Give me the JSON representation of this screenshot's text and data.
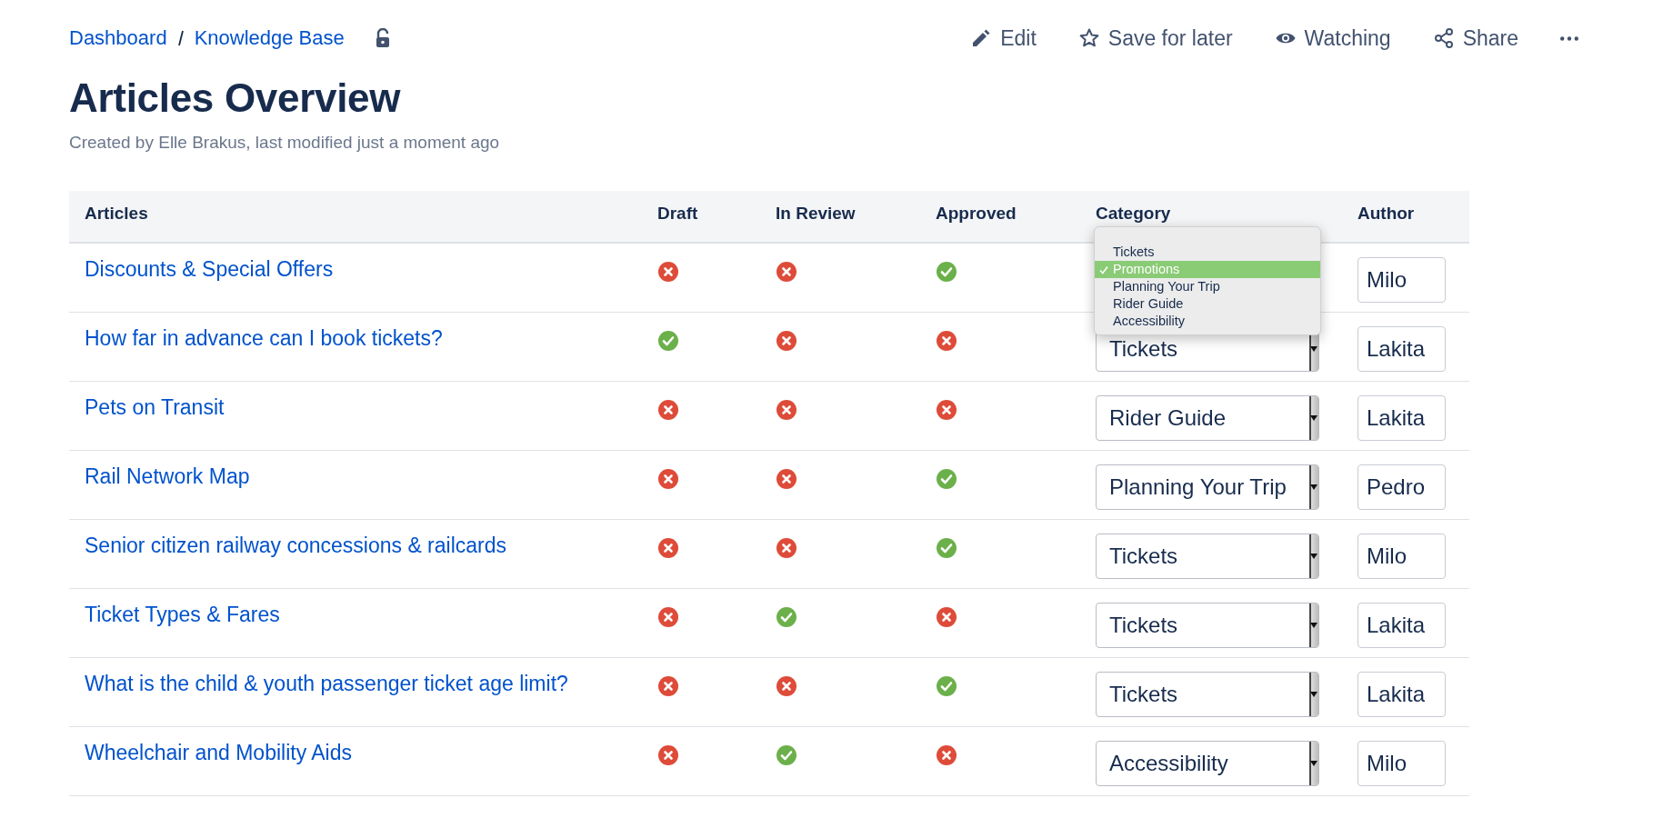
{
  "breadcrumbs": [
    "Dashboard",
    "Knowledge Base"
  ],
  "restricted": false,
  "actions": [
    {
      "kind": "edit",
      "label": "Edit"
    },
    {
      "kind": "save",
      "label": "Save for later"
    },
    {
      "kind": "watch",
      "label": "Watching"
    },
    {
      "kind": "share",
      "label": "Share"
    },
    {
      "kind": "more"
    }
  ],
  "title": "Articles Overview",
  "byline": "Created by Elle Brakus, last modified just a moment ago",
  "table": {
    "columns": [
      "Articles",
      "Draft",
      "In Review",
      "Approved",
      "Category",
      "Author"
    ],
    "rows": [
      {
        "article": "Discounts & Special Offers",
        "draft": false,
        "in_review": false,
        "approved": true,
        "category": {
          "open": true,
          "options": [
            {
              "label": "Tickets",
              "selected": false
            },
            {
              "label": "Promotions",
              "selected": true
            },
            {
              "label": "Planning Your Trip",
              "selected": false
            },
            {
              "label": "Rider Guide",
              "selected": false
            },
            {
              "label": "Accessibility",
              "selected": false
            }
          ]
        },
        "author": "Milo"
      },
      {
        "article": "How far in advance can I book tickets?",
        "draft": true,
        "in_review": false,
        "approved": false,
        "category": {
          "open": false,
          "value": "Tickets"
        },
        "author": "Lakita"
      },
      {
        "article": "Pets on Transit",
        "draft": false,
        "in_review": false,
        "approved": false,
        "category": {
          "open": false,
          "value": "Rider Guide"
        },
        "author": "Lakita"
      },
      {
        "article": "Rail Network Map",
        "draft": false,
        "in_review": false,
        "approved": true,
        "category": {
          "open": false,
          "value": "Planning Your Trip"
        },
        "author": "Pedro"
      },
      {
        "article": "Senior citizen railway concessions & railcards",
        "draft": false,
        "in_review": false,
        "approved": true,
        "category": {
          "open": false,
          "value": "Tickets"
        },
        "author": "Milo"
      },
      {
        "article": "Ticket Types & Fares",
        "draft": false,
        "in_review": true,
        "approved": false,
        "category": {
          "open": false,
          "value": "Tickets"
        },
        "author": "Lakita"
      },
      {
        "article": "What is the child & youth passenger ticket age limit?",
        "draft": false,
        "in_review": false,
        "approved": true,
        "category": {
          "open": false,
          "value": "Tickets"
        },
        "author": "Lakita"
      },
      {
        "article": "Wheelchair and Mobility Aids",
        "draft": false,
        "in_review": true,
        "approved": false,
        "category": {
          "open": false,
          "value": "Accessibility"
        },
        "author": "Milo"
      }
    ]
  }
}
